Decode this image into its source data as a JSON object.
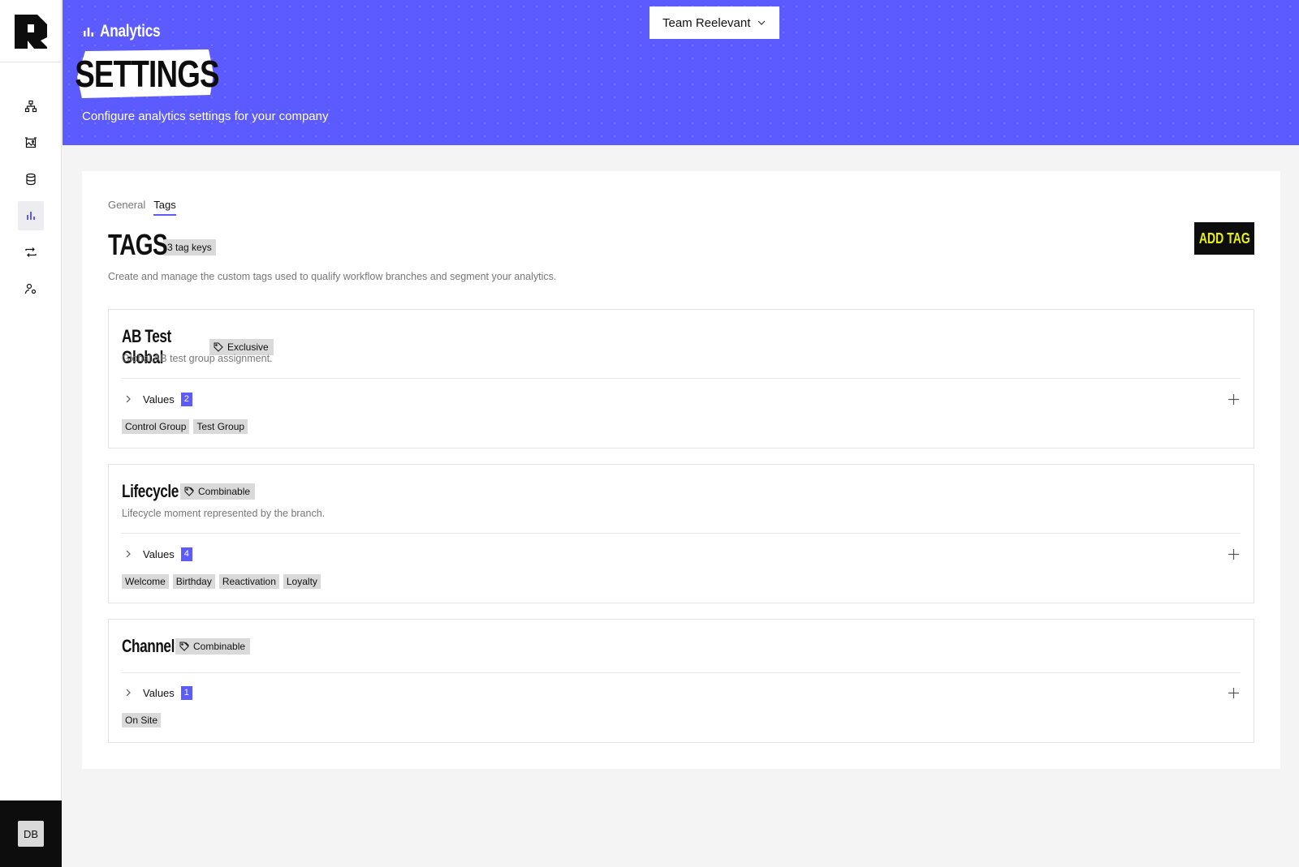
{
  "team": {
    "selected": "Team Reelevant"
  },
  "header": {
    "section": "Analytics",
    "title": "SETTINGS",
    "subtitle": "Configure analytics settings for your company"
  },
  "user": {
    "initials": "DB"
  },
  "sidebar": {
    "items": [
      {
        "icon": "hierarchy-icon",
        "active": false
      },
      {
        "icon": "image-gallery-icon",
        "active": false
      },
      {
        "icon": "database-icon",
        "active": false
      },
      {
        "icon": "analytics-icon",
        "active": true
      },
      {
        "icon": "sync-icon",
        "active": false
      },
      {
        "icon": "user-settings-icon",
        "active": false
      }
    ]
  },
  "tabs": [
    {
      "label": "General",
      "active": false
    },
    {
      "label": "Tags",
      "active": true
    }
  ],
  "section": {
    "title": "TAGS",
    "count_label": "3 tag keys",
    "description": "Create and manage the custom tags used to qualify workflow branches and segment your analytics.",
    "add_button": "ADD TAG"
  },
  "tags": [
    {
      "name": "AB Test Global",
      "type": "Exclusive",
      "description": "Global AB test group assignment.",
      "values_label": "Values",
      "values_count": "2",
      "values": [
        "Control Group",
        "Test Group"
      ]
    },
    {
      "name": "Lifecycle",
      "type": "Combinable",
      "description": "Lifecycle moment represented by the branch.",
      "values_label": "Values",
      "values_count": "4",
      "values": [
        "Welcome",
        "Birthday",
        "Reactivation",
        "Loyalty"
      ]
    },
    {
      "name": "Channel",
      "type": "Combinable",
      "description": "",
      "values_label": "Values",
      "values_count": "1",
      "values": [
        "On Site"
      ]
    }
  ],
  "colors": {
    "accent": "#5b5bff",
    "dark": "#0d0d0d",
    "button_text": "#e8f013",
    "chip": "#d9d9d9"
  }
}
